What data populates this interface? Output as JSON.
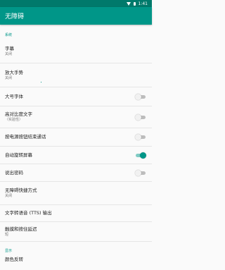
{
  "status_bar": {
    "time": "1:41"
  },
  "app_bar": {
    "title": "无障碍"
  },
  "sections": {
    "system": "系统",
    "display": "显示"
  },
  "items": {
    "captions": {
      "title": "字幕",
      "subtitle": "关闭"
    },
    "magnification": {
      "title": "放大手势",
      "subtitle": "关闭"
    },
    "large_text": {
      "title": "大号字体",
      "checked": false
    },
    "high_contrast": {
      "title": "高对比度文字",
      "subtitle": "（实验性）",
      "checked": false
    },
    "power_ends_call": {
      "title": "按电源按钮结束通话",
      "checked": false
    },
    "auto_rotate": {
      "title": "自动旋转屏幕",
      "checked": true
    },
    "speak_passwords": {
      "title": "说出密码",
      "checked": false
    },
    "shortcut": {
      "title": "无障碍快捷方式",
      "subtitle": "关闭"
    },
    "tts": {
      "title": "文字转语音 (TTS) 输出"
    },
    "touch_hold": {
      "title": "触摸和按住延迟",
      "subtitle": "短"
    },
    "color_inversion": {
      "title": "颜色反转"
    }
  },
  "colors": {
    "primary": "#009688",
    "primary_dark": "#00796b",
    "accent": "#009688"
  }
}
